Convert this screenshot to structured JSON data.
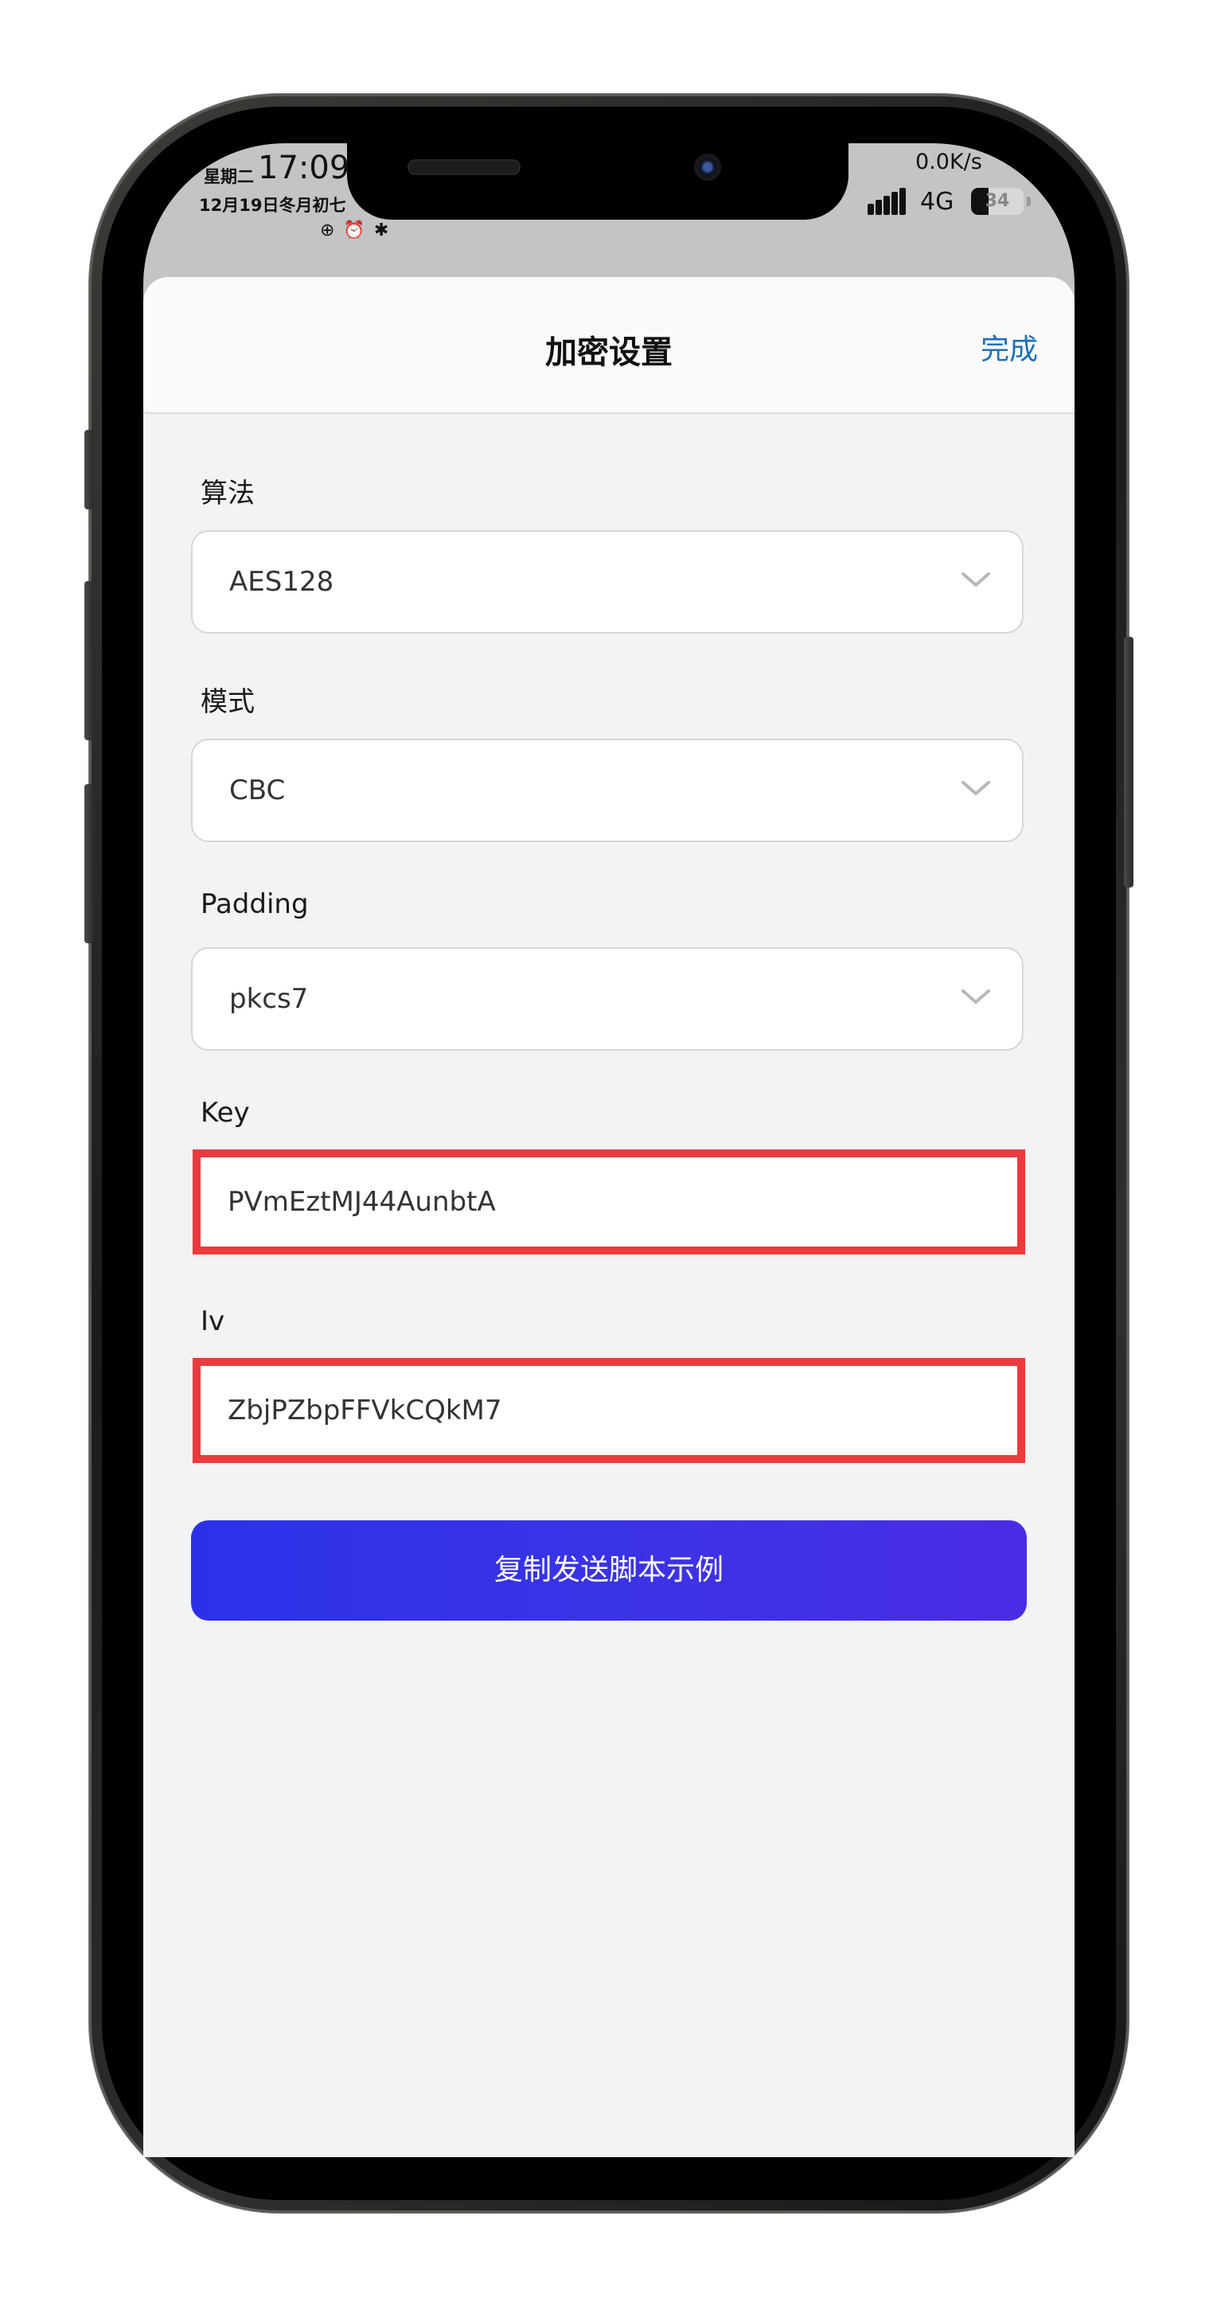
{
  "status_bar": {
    "weekday": "星期二",
    "time": "17:09",
    "date": "12月19日冬月初七",
    "left_icons": "⊕ ⏰ ✱",
    "network_speed": "0.0K/s",
    "network_type": "4G",
    "battery_level": "34",
    "battery_fraction": 0.34
  },
  "sheet": {
    "title": "加密设置",
    "done_label": "完成"
  },
  "form": {
    "algorithm": {
      "label": "算法",
      "value": "AES128"
    },
    "mode": {
      "label": "模式",
      "value": "CBC"
    },
    "padding": {
      "label": "Padding",
      "value": "pkcs7"
    },
    "key": {
      "label": "Key",
      "value": "PVmEztMJ44AunbtA"
    },
    "iv": {
      "label": "Iv",
      "value": "ZbjPZbpFFVkCQkM7"
    }
  },
  "actions": {
    "copy_script_label": "复制发送脚本示例"
  },
  "colors": {
    "accent_link": "#1e6fb8",
    "button_gradient_start": "#2c31e9",
    "button_gradient_end": "#4a2ce4",
    "highlight_border": "#ec3a3e"
  }
}
